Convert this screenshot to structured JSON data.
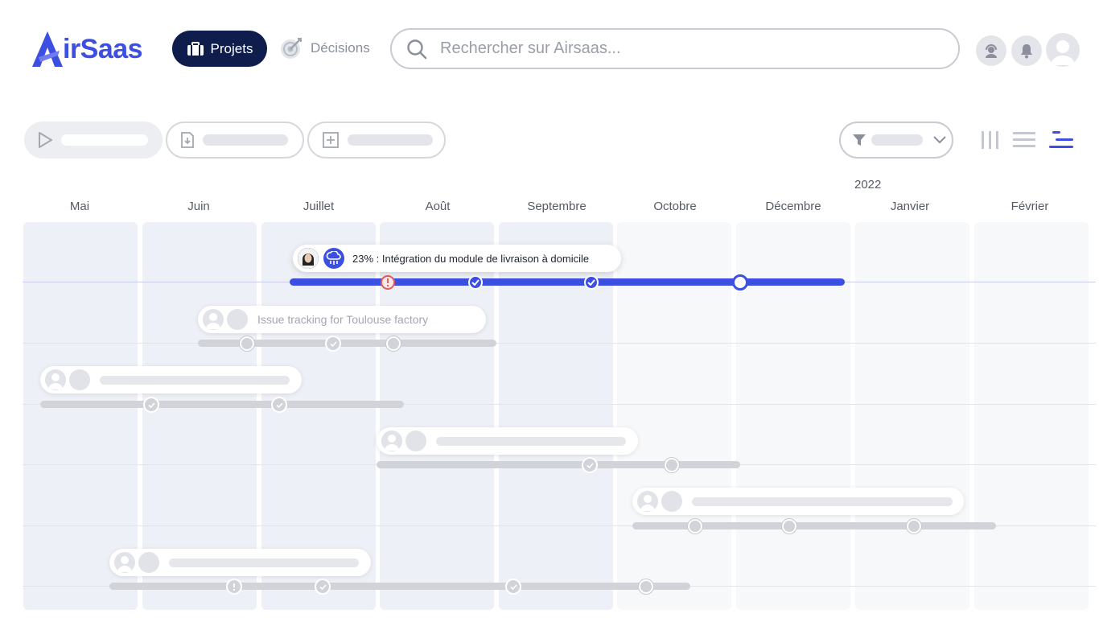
{
  "header": {
    "logo_text": "irSaas",
    "nav": {
      "projets": "Projets",
      "decisions": "Décisions"
    },
    "search_placeholder": "Rechercher sur Airsaas..."
  },
  "timeline": {
    "year_label": "2022",
    "months": [
      "Mai",
      "Juin",
      "Juillet",
      "Août",
      "Septembre",
      "Octobre",
      "Décembre",
      "Janvier",
      "Février"
    ],
    "projects": [
      {
        "label": "23% : Intégration du module de livraison à domicile",
        "status": "active",
        "progress_percent": 23
      },
      {
        "label": "Issue tracking for Toulouse factory",
        "status": "faded"
      }
    ]
  },
  "colors": {
    "brand": "#3d4fe0",
    "nav_active_bg": "#0f1d4d",
    "track_active": "#3d4fe0",
    "track_inactive": "#d1d3d8",
    "alert": "#e45b5b"
  }
}
